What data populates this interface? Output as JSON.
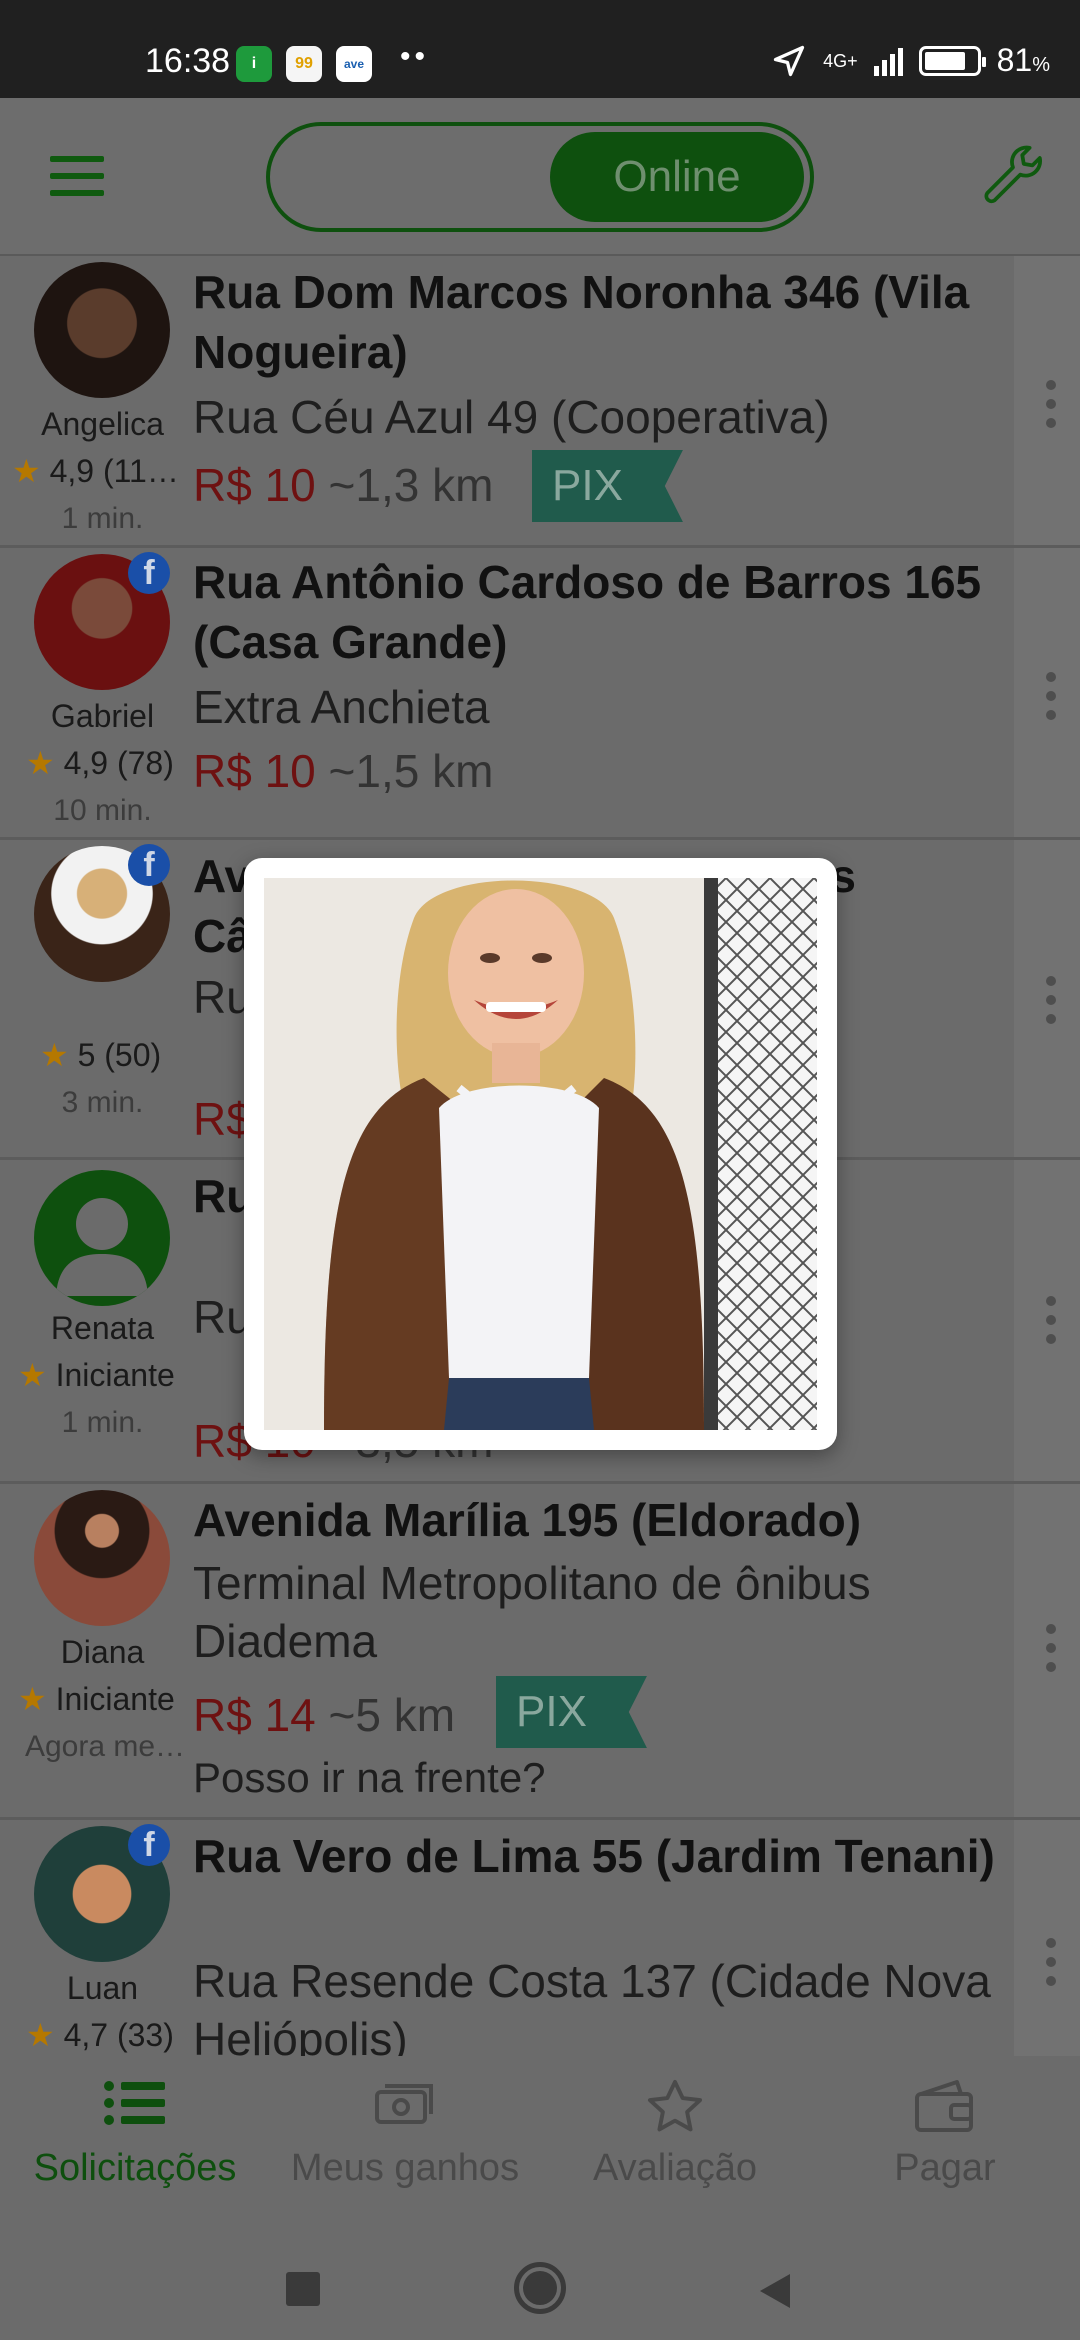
{
  "status_bar": {
    "time": "16:38",
    "apps": [
      "i",
      "99",
      "ave"
    ],
    "more": "••",
    "network": "4G+",
    "battery": "81",
    "battery_unit": "%",
    "battery_level": 0.81
  },
  "topbar": {
    "toggle_label": "Online"
  },
  "requests": [
    {
      "name": "Angelica",
      "rating": "4,9 (11…",
      "time": "1 min.",
      "origin": "Rua Dom Marcos Noronha 346 (Vila Nogueira)",
      "destination": "Rua Céu Azul 49 (Cooperativa)",
      "price": "R$ 10",
      "distance": "~1,3 km",
      "payment": "PIX",
      "facebook": false
    },
    {
      "name": "Gabriel",
      "rating": "4,9 (78)",
      "time": "10 min.",
      "origin": "Rua Antônio Cardoso de Barros 165 (Casa Grande)",
      "destination": "Extra Anchieta",
      "price": "R$ 10",
      "distance": "~1,5 km",
      "facebook": true
    },
    {
      "name": "",
      "rating": "5 (50)",
      "time": "3 min.",
      "origin": "Avenida Dom Jaime de Barros Câmara",
      "destination": "Rua Dom",
      "price": "R$",
      "facebook": true
    },
    {
      "name": "Renata",
      "rating": "Iniciante",
      "time": "1 min.",
      "origin": "Ru da So",
      "destination": "Ru (Vila Inc",
      "price": "R$ 10",
      "distance": "~3,5 km",
      "facebook": false
    },
    {
      "name": "Diana",
      "rating": "Iniciante",
      "time": "Agora me…",
      "origin": "Avenida Marília 195 (Eldorado)",
      "destination": "Terminal Metropolitano de ônibus Diadema",
      "price": "R$ 14",
      "distance": "~5 km",
      "payment": "PIX",
      "note": "Posso ir na frente?",
      "facebook": false
    },
    {
      "name": "Luan",
      "rating": "4,7 (33)",
      "origin": "Rua Vero de Lima 55 (Jardim Tenani)",
      "destination": "Rua Resende Costa 137 (Cidade Nova Heliópolis)",
      "facebook": true
    }
  ],
  "bottom_nav": [
    {
      "label": "Solicitações",
      "icon": "list-icon",
      "active": true
    },
    {
      "label": "Meus ganhos",
      "icon": "money-icon",
      "active": false
    },
    {
      "label": "Avaliação",
      "icon": "star-icon",
      "active": false
    },
    {
      "label": "Pagar",
      "icon": "wallet-icon",
      "active": false
    }
  ],
  "colors": {
    "accent": "#1e8a1e",
    "price": "#c0392b",
    "pix": "#2b8a6e"
  }
}
